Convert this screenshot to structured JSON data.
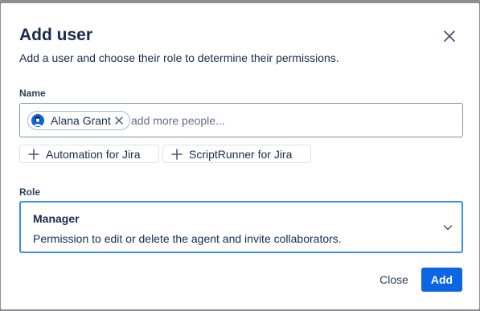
{
  "dialog": {
    "title": "Add user",
    "subtitle": "Add a user and choose their role to determine their permissions."
  },
  "name_field": {
    "label": "Name",
    "placeholder": "add more people...",
    "value": "",
    "selected_users": [
      {
        "name": "Alana Grant"
      }
    ]
  },
  "suggestions": [
    {
      "label": "Automation for Jira"
    },
    {
      "label": "ScriptRunner for Jira"
    }
  ],
  "role_field": {
    "label": "Role",
    "selected_role": "Manager",
    "selected_description": "Permission to edit or delete the agent and invite collaborators."
  },
  "footer": {
    "close_label": "Close",
    "add_label": "Add"
  },
  "colors": {
    "primary": "#0c66e4",
    "focus_border": "#388bff",
    "text": "#172b4d",
    "overlay": "#8c8f94"
  },
  "icons": {
    "close": "close-icon",
    "remove": "remove-chip-icon",
    "add": "plus-icon",
    "dropdown": "chevron-down-icon",
    "avatar": "avatar-icon"
  }
}
